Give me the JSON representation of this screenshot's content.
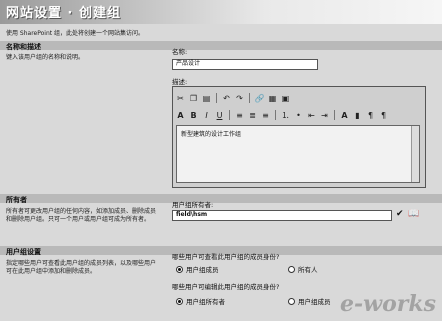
{
  "header": {
    "title": "网站设置 · 创建组"
  },
  "intro": {
    "text": "使用 SharePoint 组，此处将创建一个网站集访问。"
  },
  "sections": {
    "name_desc": {
      "title": "名称和描述",
      "description": "键入该用户组的名称和说明。",
      "name_label": "名称:",
      "name_value": "产品设计",
      "desc_label": "描述:",
      "desc_value": "新型建筑的设计工作组"
    },
    "owner": {
      "title": "所有者",
      "description": "所有者可更改用户组的任何内容，如添加成员、删除成员和删除用户组。只可一个用户或用户组可成为所有者。",
      "label": "用户组所有者:",
      "value": "field\\hsm"
    },
    "settings": {
      "title": "用户组设置",
      "description": "指定哪些用户可查看此用户组的成员列表，以及哪些用户可在此用户组中添加和删除成员。",
      "q1": "哪些用户可查看此用户组的成员身份?",
      "q1_options": [
        "用户组成员",
        "所有人"
      ],
      "q2": "哪些用户可编辑此用户组的成员身份?",
      "q2_options": [
        "用户组所有者",
        "用户组成员"
      ]
    }
  },
  "toolbar": {
    "row1_icons": [
      "cut-icon",
      "copy-icon",
      "paste-icon",
      "undo-icon",
      "redo-icon",
      "link-icon",
      "table-icon",
      "image-icon"
    ],
    "row2_icons": [
      "font-color-icon",
      "bold-icon",
      "italic-icon",
      "underline-icon",
      "align-left-icon",
      "align-center-icon",
      "align-right-icon",
      "numbered-list-icon",
      "bullet-list-icon",
      "outdent-icon",
      "indent-icon",
      "text-color-icon",
      "highlight-icon",
      "ltr-icon",
      "rtl-icon"
    ]
  },
  "watermark": "e-works"
}
